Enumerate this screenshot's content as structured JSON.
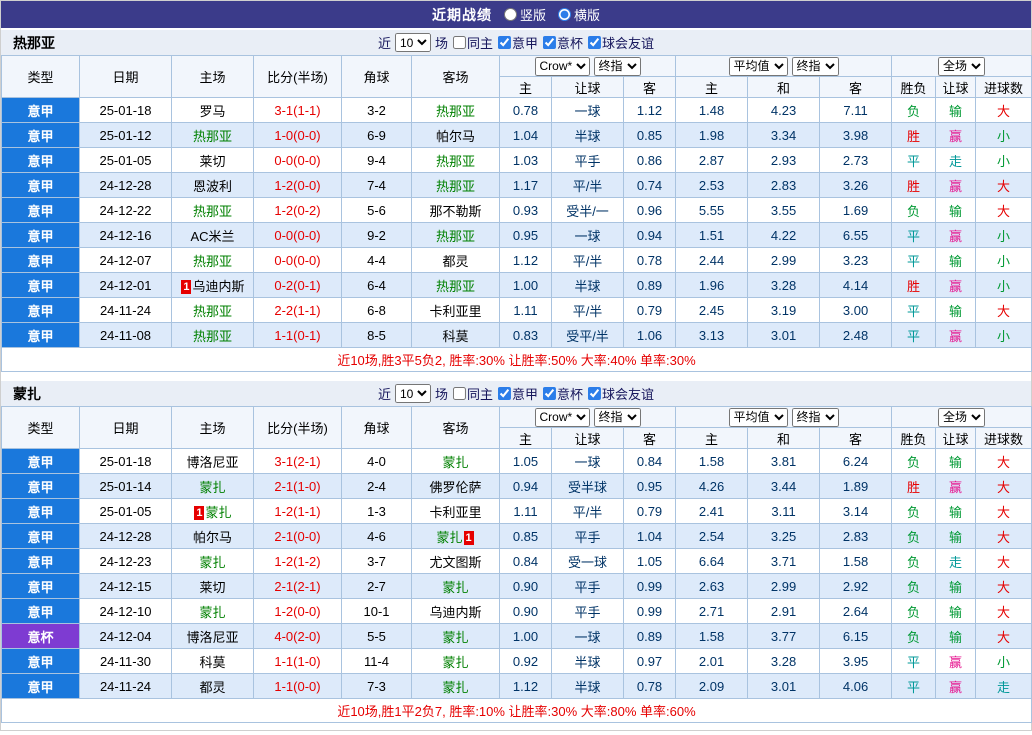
{
  "topbar": {
    "title": "近期战绩",
    "options": [
      {
        "label": "竖版",
        "checked": false
      },
      {
        "label": "横版",
        "checked": true
      }
    ]
  },
  "filter": {
    "prefix": "近",
    "count": "10",
    "suffix": "场",
    "checkboxes": [
      {
        "id": "same-home",
        "label": "同主",
        "checked": false
      },
      {
        "id": "serie-a",
        "label": "意甲",
        "checked": true
      },
      {
        "id": "coppa-italia",
        "label": "意杯",
        "checked": true
      },
      {
        "id": "club-friendly",
        "label": "球会友谊",
        "checked": true
      }
    ]
  },
  "table_header": {
    "static_cols": [
      "类型",
      "日期",
      "主场",
      "比分(半场)",
      "角球",
      "客场"
    ],
    "group1": {
      "selects": [
        "Crow*",
        "终指"
      ],
      "cols": [
        "主",
        "让球",
        "客"
      ]
    },
    "group2": {
      "selects": [
        "平均值",
        "终指"
      ],
      "cols": [
        "主",
        "和",
        "客"
      ]
    },
    "group3": {
      "selects": [
        "全场"
      ],
      "cols": [
        "胜负",
        "让球",
        "进球数"
      ]
    }
  },
  "colors": {
    "topbar_bg": "#3b3b8a",
    "league_badge": "#1a78dc",
    "cup_badge": "#7e3bd2",
    "win_red": "#e60000",
    "lose_green": "#009933",
    "draw_teal": "#009898",
    "handicap_win_pink": "#e6148f",
    "subject_team_green": "#008000",
    "score_red": "#e60000",
    "summary_red": "#e60000"
  },
  "sections": [
    {
      "team": "热那亚",
      "rows": [
        {
          "t": "意甲",
          "tc": "league",
          "d": "25-01-18",
          "h": {
            "n": "罗马",
            "s": false
          },
          "sc": "3-1(1-1)",
          "cn": "3-2",
          "a": {
            "n": "热那亚",
            "s": true
          },
          "o1": [
            "0.78",
            "一球",
            "1.12"
          ],
          "o2": [
            "1.48",
            "4.23",
            "7.11"
          ],
          "r": [
            [
              "负",
              "g"
            ],
            [
              "输",
              "g"
            ],
            [
              "大",
              "r"
            ]
          ]
        },
        {
          "t": "意甲",
          "tc": "league",
          "d": "25-01-12",
          "h": {
            "n": "热那亚",
            "s": true
          },
          "sc": "1-0(0-0)",
          "cn": "6-9",
          "a": {
            "n": "帕尔马",
            "s": false
          },
          "o1": [
            "1.04",
            "半球",
            "0.85"
          ],
          "o2": [
            "1.98",
            "3.34",
            "3.98"
          ],
          "r": [
            [
              "胜",
              "r"
            ],
            [
              "赢",
              "p"
            ],
            [
              "小",
              "g"
            ]
          ]
        },
        {
          "t": "意甲",
          "tc": "league",
          "d": "25-01-05",
          "h": {
            "n": "莱切",
            "s": false
          },
          "sc": "0-0(0-0)",
          "cn": "9-4",
          "a": {
            "n": "热那亚",
            "s": true
          },
          "o1": [
            "1.03",
            "平手",
            "0.86"
          ],
          "o2": [
            "2.87",
            "2.93",
            "2.73"
          ],
          "r": [
            [
              "平",
              "t"
            ],
            [
              "走",
              "t"
            ],
            [
              "小",
              "g"
            ]
          ]
        },
        {
          "t": "意甲",
          "tc": "league",
          "d": "24-12-28",
          "h": {
            "n": "恩波利",
            "s": false
          },
          "sc": "1-2(0-0)",
          "cn": "7-4",
          "a": {
            "n": "热那亚",
            "s": true
          },
          "o1": [
            "1.17",
            "平/半",
            "0.74"
          ],
          "o2": [
            "2.53",
            "2.83",
            "3.26"
          ],
          "r": [
            [
              "胜",
              "r"
            ],
            [
              "赢",
              "p"
            ],
            [
              "大",
              "r"
            ]
          ]
        },
        {
          "t": "意甲",
          "tc": "league",
          "d": "24-12-22",
          "h": {
            "n": "热那亚",
            "s": true
          },
          "sc": "1-2(0-2)",
          "cn": "5-6",
          "a": {
            "n": "那不勒斯",
            "s": false
          },
          "o1": [
            "0.93",
            "受半/一",
            "0.96"
          ],
          "o2": [
            "5.55",
            "3.55",
            "1.69"
          ],
          "r": [
            [
              "负",
              "g"
            ],
            [
              "输",
              "g"
            ],
            [
              "大",
              "r"
            ]
          ]
        },
        {
          "t": "意甲",
          "tc": "league",
          "d": "24-12-16",
          "h": {
            "n": "AC米兰",
            "s": false
          },
          "sc": "0-0(0-0)",
          "cn": "9-2",
          "a": {
            "n": "热那亚",
            "s": true
          },
          "o1": [
            "0.95",
            "一球",
            "0.94"
          ],
          "o2": [
            "1.51",
            "4.22",
            "6.55"
          ],
          "r": [
            [
              "平",
              "t"
            ],
            [
              "赢",
              "p"
            ],
            [
              "小",
              "g"
            ]
          ]
        },
        {
          "t": "意甲",
          "tc": "league",
          "d": "24-12-07",
          "h": {
            "n": "热那亚",
            "s": true
          },
          "sc": "0-0(0-0)",
          "cn": "4-4",
          "a": {
            "n": "都灵",
            "s": false
          },
          "o1": [
            "1.12",
            "平/半",
            "0.78"
          ],
          "o2": [
            "2.44",
            "2.99",
            "3.23"
          ],
          "r": [
            [
              "平",
              "t"
            ],
            [
              "输",
              "g"
            ],
            [
              "小",
              "g"
            ]
          ]
        },
        {
          "t": "意甲",
          "tc": "league",
          "d": "24-12-01",
          "h": {
            "n": "乌迪内斯",
            "s": false,
            "bp": "1"
          },
          "sc": "0-2(0-1)",
          "cn": "6-4",
          "a": {
            "n": "热那亚",
            "s": true
          },
          "o1": [
            "1.00",
            "半球",
            "0.89"
          ],
          "o2": [
            "1.96",
            "3.28",
            "4.14"
          ],
          "r": [
            [
              "胜",
              "r"
            ],
            [
              "赢",
              "p"
            ],
            [
              "小",
              "g"
            ]
          ]
        },
        {
          "t": "意甲",
          "tc": "league",
          "d": "24-11-24",
          "h": {
            "n": "热那亚",
            "s": true
          },
          "sc": "2-2(1-1)",
          "cn": "6-8",
          "a": {
            "n": "卡利亚里",
            "s": false
          },
          "o1": [
            "1.11",
            "平/半",
            "0.79"
          ],
          "o2": [
            "2.45",
            "3.19",
            "3.00"
          ],
          "r": [
            [
              "平",
              "t"
            ],
            [
              "输",
              "g"
            ],
            [
              "大",
              "r"
            ]
          ]
        },
        {
          "t": "意甲",
          "tc": "league",
          "d": "24-11-08",
          "h": {
            "n": "热那亚",
            "s": true
          },
          "sc": "1-1(0-1)",
          "cn": "8-5",
          "a": {
            "n": "科莫",
            "s": false
          },
          "o1": [
            "0.83",
            "受平/半",
            "1.06"
          ],
          "o2": [
            "3.13",
            "3.01",
            "2.48"
          ],
          "r": [
            [
              "平",
              "t"
            ],
            [
              "赢",
              "p"
            ],
            [
              "小",
              "g"
            ]
          ]
        }
      ],
      "summary": "近10场,胜3平5负2, 胜率:30% 让胜率:50% 大率:40% 单率:30%"
    },
    {
      "team": "蒙扎",
      "rows": [
        {
          "t": "意甲",
          "tc": "league",
          "d": "25-01-18",
          "h": {
            "n": "博洛尼亚",
            "s": false
          },
          "sc": "3-1(2-1)",
          "cn": "4-0",
          "a": {
            "n": "蒙扎",
            "s": true
          },
          "o1": [
            "1.05",
            "一球",
            "0.84"
          ],
          "o2": [
            "1.58",
            "3.81",
            "6.24"
          ],
          "r": [
            [
              "负",
              "g"
            ],
            [
              "输",
              "g"
            ],
            [
              "大",
              "r"
            ]
          ]
        },
        {
          "t": "意甲",
          "tc": "league",
          "d": "25-01-14",
          "h": {
            "n": "蒙扎",
            "s": true
          },
          "sc": "2-1(1-0)",
          "cn": "2-4",
          "a": {
            "n": "佛罗伦萨",
            "s": false
          },
          "o1": [
            "0.94",
            "受半球",
            "0.95"
          ],
          "o2": [
            "4.26",
            "3.44",
            "1.89"
          ],
          "r": [
            [
              "胜",
              "r"
            ],
            [
              "赢",
              "p"
            ],
            [
              "大",
              "r"
            ]
          ]
        },
        {
          "t": "意甲",
          "tc": "league",
          "d": "25-01-05",
          "h": {
            "n": "蒙扎",
            "s": true,
            "bp": "1"
          },
          "sc": "1-2(1-1)",
          "cn": "1-3",
          "a": {
            "n": "卡利亚里",
            "s": false
          },
          "o1": [
            "1.11",
            "平/半",
            "0.79"
          ],
          "o2": [
            "2.41",
            "3.11",
            "3.14"
          ],
          "r": [
            [
              "负",
              "g"
            ],
            [
              "输",
              "g"
            ],
            [
              "大",
              "r"
            ]
          ]
        },
        {
          "t": "意甲",
          "tc": "league",
          "d": "24-12-28",
          "h": {
            "n": "帕尔马",
            "s": false
          },
          "sc": "2-1(0-0)",
          "cn": "4-6",
          "a": {
            "n": "蒙扎",
            "s": true,
            "ba": "1"
          },
          "o1": [
            "0.85",
            "平手",
            "1.04"
          ],
          "o2": [
            "2.54",
            "3.25",
            "2.83"
          ],
          "r": [
            [
              "负",
              "g"
            ],
            [
              "输",
              "g"
            ],
            [
              "大",
              "r"
            ]
          ]
        },
        {
          "t": "意甲",
          "tc": "league",
          "d": "24-12-23",
          "h": {
            "n": "蒙扎",
            "s": true
          },
          "sc": "1-2(1-2)",
          "cn": "3-7",
          "a": {
            "n": "尤文图斯",
            "s": false
          },
          "o1": [
            "0.84",
            "受一球",
            "1.05"
          ],
          "o2": [
            "6.64",
            "3.71",
            "1.58"
          ],
          "r": [
            [
              "负",
              "g"
            ],
            [
              "走",
              "t"
            ],
            [
              "大",
              "r"
            ]
          ]
        },
        {
          "t": "意甲",
          "tc": "league",
          "d": "24-12-15",
          "h": {
            "n": "莱切",
            "s": false
          },
          "sc": "2-1(2-1)",
          "cn": "2-7",
          "a": {
            "n": "蒙扎",
            "s": true
          },
          "o1": [
            "0.90",
            "平手",
            "0.99"
          ],
          "o2": [
            "2.63",
            "2.99",
            "2.92"
          ],
          "r": [
            [
              "负",
              "g"
            ],
            [
              "输",
              "g"
            ],
            [
              "大",
              "r"
            ]
          ]
        },
        {
          "t": "意甲",
          "tc": "league",
          "d": "24-12-10",
          "h": {
            "n": "蒙扎",
            "s": true
          },
          "sc": "1-2(0-0)",
          "cn": "10-1",
          "a": {
            "n": "乌迪内斯",
            "s": false
          },
          "o1": [
            "0.90",
            "平手",
            "0.99"
          ],
          "o2": [
            "2.71",
            "2.91",
            "2.64"
          ],
          "r": [
            [
              "负",
              "g"
            ],
            [
              "输",
              "g"
            ],
            [
              "大",
              "r"
            ]
          ]
        },
        {
          "t": "意杯",
          "tc": "cup",
          "d": "24-12-04",
          "h": {
            "n": "博洛尼亚",
            "s": false
          },
          "sc": "4-0(2-0)",
          "cn": "5-5",
          "a": {
            "n": "蒙扎",
            "s": true
          },
          "o1": [
            "1.00",
            "一球",
            "0.89"
          ],
          "o2": [
            "1.58",
            "3.77",
            "6.15"
          ],
          "r": [
            [
              "负",
              "g"
            ],
            [
              "输",
              "g"
            ],
            [
              "大",
              "r"
            ]
          ]
        },
        {
          "t": "意甲",
          "tc": "league",
          "d": "24-11-30",
          "h": {
            "n": "科莫",
            "s": false
          },
          "sc": "1-1(1-0)",
          "cn": "11-4",
          "a": {
            "n": "蒙扎",
            "s": true
          },
          "o1": [
            "0.92",
            "半球",
            "0.97"
          ],
          "o2": [
            "2.01",
            "3.28",
            "3.95"
          ],
          "r": [
            [
              "平",
              "t"
            ],
            [
              "赢",
              "p"
            ],
            [
              "小",
              "g"
            ]
          ]
        },
        {
          "t": "意甲",
          "tc": "league",
          "d": "24-11-24",
          "h": {
            "n": "都灵",
            "s": false
          },
          "sc": "1-1(0-0)",
          "cn": "7-3",
          "a": {
            "n": "蒙扎",
            "s": true
          },
          "o1": [
            "1.12",
            "半球",
            "0.78"
          ],
          "o2": [
            "2.09",
            "3.01",
            "4.06"
          ],
          "r": [
            [
              "平",
              "t"
            ],
            [
              "赢",
              "p"
            ],
            [
              "走",
              "t"
            ]
          ]
        }
      ],
      "summary": "近10场,胜1平2负7, 胜率:10% 让胜率:30% 大率:80% 单率:60%"
    }
  ]
}
